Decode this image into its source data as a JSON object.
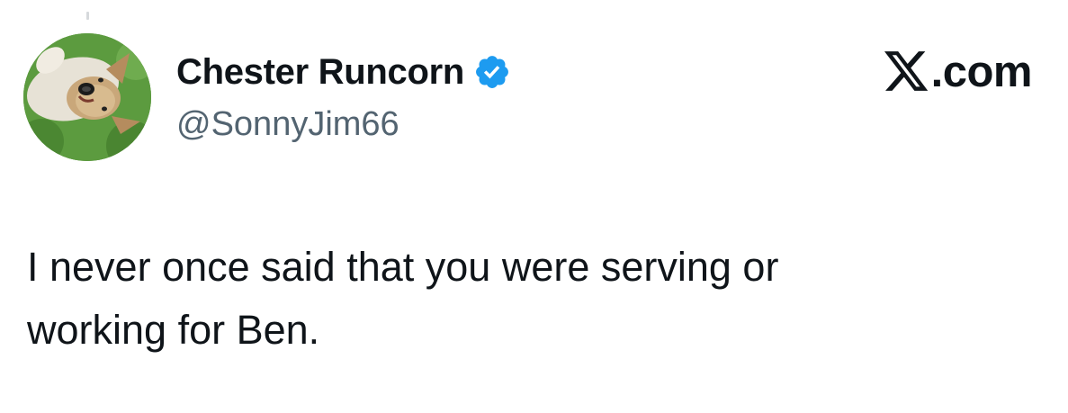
{
  "author": {
    "display_name": "Chester Runcorn",
    "handle": "@SonnyJim66",
    "verified": true,
    "avatar_subject": "dog lying on grass"
  },
  "brand": {
    "label": ".com",
    "icon": "x-logo-icon"
  },
  "tweet": {
    "text": "I never once said that you were serving or\nworking for Ben."
  },
  "colors": {
    "verified_badge": "#1d9bf0",
    "handle_text": "#536471",
    "primary_text": "#0f1419",
    "background": "#ffffff"
  }
}
